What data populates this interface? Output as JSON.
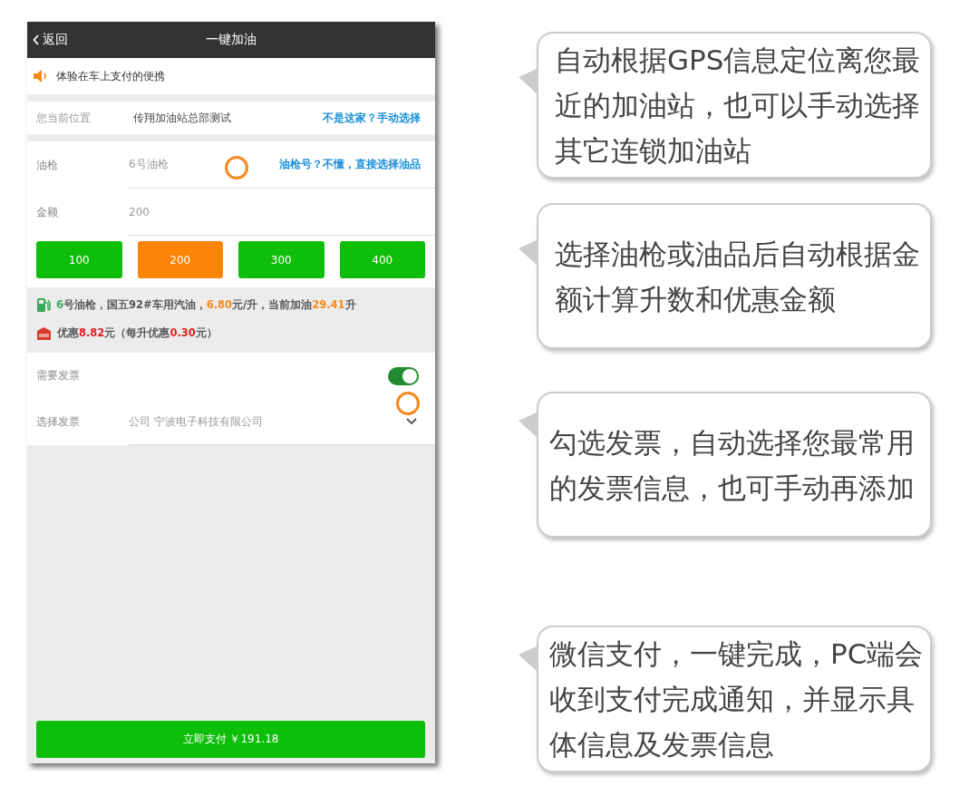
{
  "header": {
    "back": "返回",
    "title": "一键加油"
  },
  "notice": "体验在车上支付的便携",
  "location": {
    "label": "您当前位置",
    "value": "传翔加油站总部测试",
    "link": "不是这家？手动选择"
  },
  "fields": [
    {
      "label": "油枪",
      "value": "6号油枪",
      "link": "油枪号？不懂，直接选择油品"
    },
    {
      "label": "金额",
      "value": "200"
    }
  ],
  "amounts": [
    {
      "label": "100",
      "selected": false
    },
    {
      "label": "200",
      "selected": true
    },
    {
      "label": "300",
      "selected": false
    },
    {
      "label": "400",
      "selected": false
    }
  ],
  "fuel_info": [
    {
      "text": "6",
      "color": "#3aa95a"
    },
    {
      "text": "号油枪，国五92#车用汽油，"
    },
    {
      "text": "6.80",
      "color": "#f68a1e"
    },
    {
      "text": "元/升，当前加油"
    },
    {
      "text": "29.41",
      "color": "#f68a1e"
    },
    {
      "text": "升"
    }
  ],
  "discount_info": [
    {
      "text": "优惠"
    },
    {
      "text": "8.82",
      "color": "#e02020"
    },
    {
      "text": "元（每升优惠"
    },
    {
      "text": "0.30",
      "color": "#e02020"
    },
    {
      "text": "元）"
    }
  ],
  "invoice": {
    "label": "需要发票",
    "on": true,
    "select_label": "选择发票",
    "select_value": "公司  宁波电子科技有限公司"
  },
  "pay_button": "立即支付 ￥191.18",
  "callouts": [
    "自动根据GPS信息定位离您最近的加油站，也可以手动选择其它连锁加油站",
    "选择油枪或油品后自动根据金额计算升数和优惠金额",
    "勾选发票，自动选择您最常用的发票信息，也可手动再添加",
    "微信支付，一键完成，PC端会收到支付完成通知，并显示具体信息及发票信息"
  ]
}
